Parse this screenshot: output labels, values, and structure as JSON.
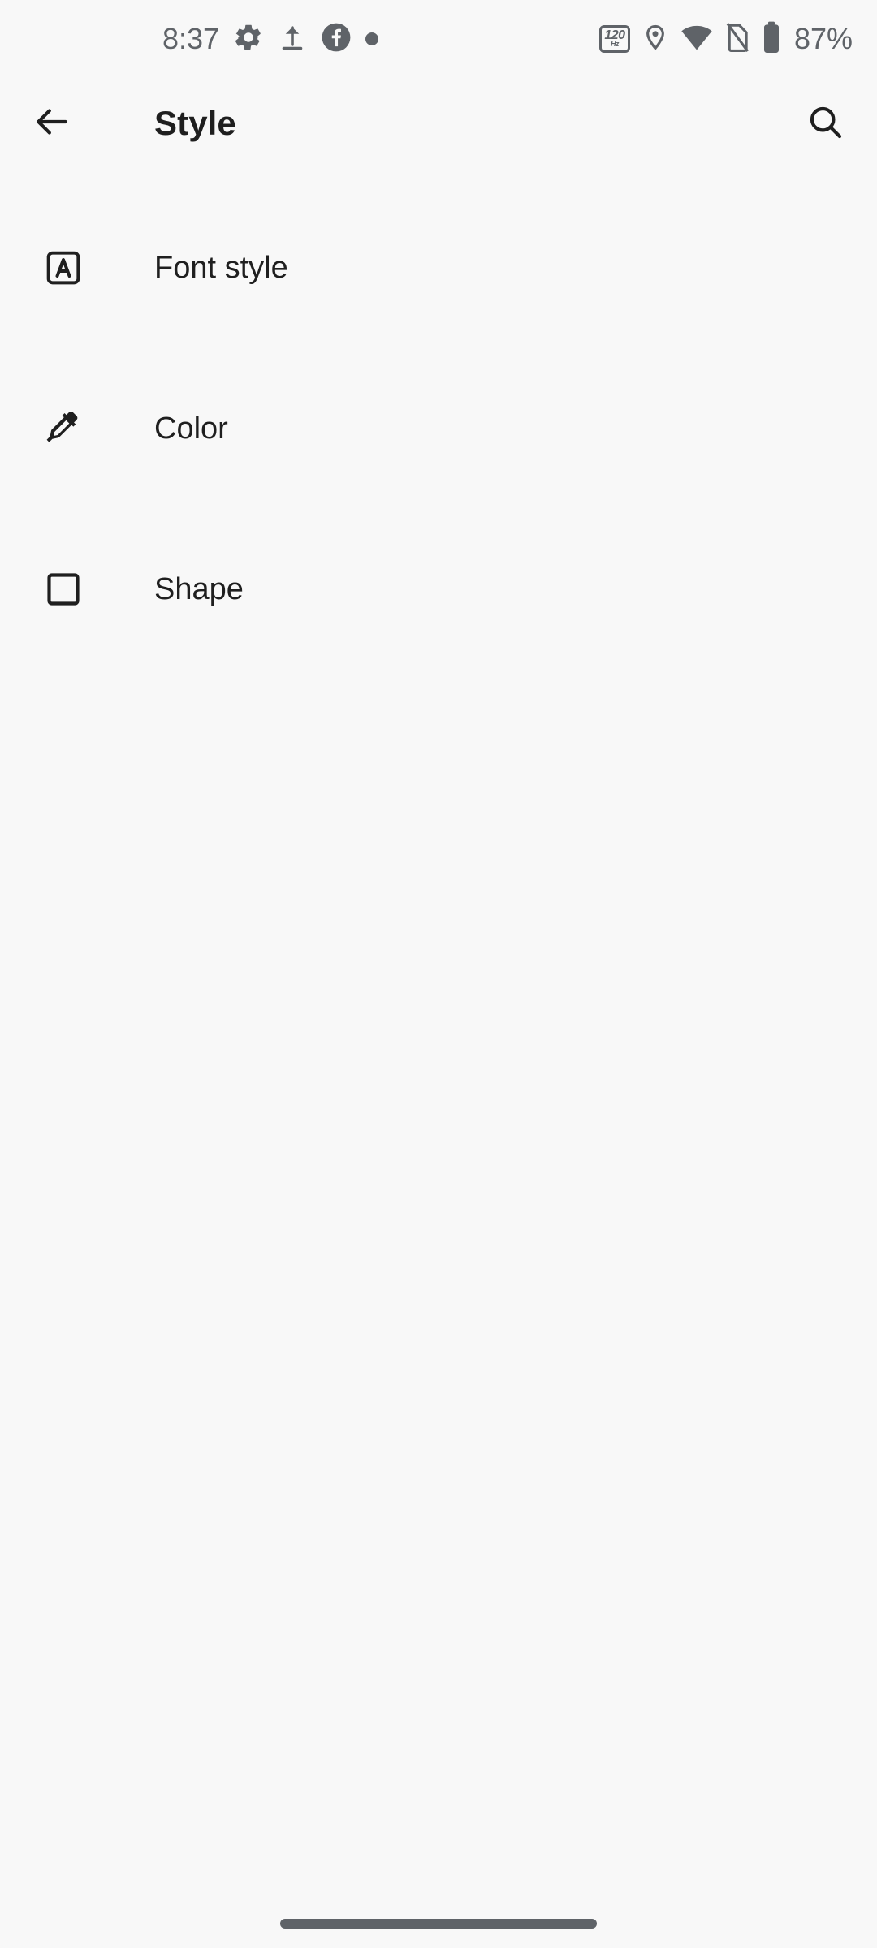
{
  "status_bar": {
    "clock": "8:37",
    "battery_percent": "87%",
    "refresh_rate_value": "120",
    "refresh_rate_unit": "Hz",
    "left_icons": [
      {
        "name": "gear-icon",
        "label": "Settings"
      },
      {
        "name": "upload-icon",
        "label": "Uploading"
      },
      {
        "name": "facebook-icon",
        "label": "Facebook"
      },
      {
        "name": "notification-dot-icon",
        "label": "Notification"
      }
    ],
    "right_icons": [
      {
        "name": "refresh-rate-badge-icon",
        "label": "120Hz"
      },
      {
        "name": "location-pin-icon",
        "label": "Location"
      },
      {
        "name": "wifi-icon",
        "label": "Wi-Fi"
      },
      {
        "name": "no-sim-icon",
        "label": "No SIM"
      },
      {
        "name": "battery-icon",
        "label": "Battery"
      }
    ]
  },
  "app_bar": {
    "title": "Style",
    "back_label": "Navigate up",
    "search_label": "Search"
  },
  "list": {
    "items": [
      {
        "label": "Font style",
        "icon": "font-style-icon"
      },
      {
        "label": "Color",
        "icon": "colorize-icon"
      },
      {
        "label": "Shape",
        "icon": "shape-icon"
      }
    ]
  },
  "nav_bar": {
    "gesture_pill_label": "Home gesture handle"
  },
  "colors": {
    "background": "#F8F8F8",
    "primary_text": "#1F1F1F",
    "status_text": "#5F6368",
    "icon": "#1F1F1F"
  }
}
